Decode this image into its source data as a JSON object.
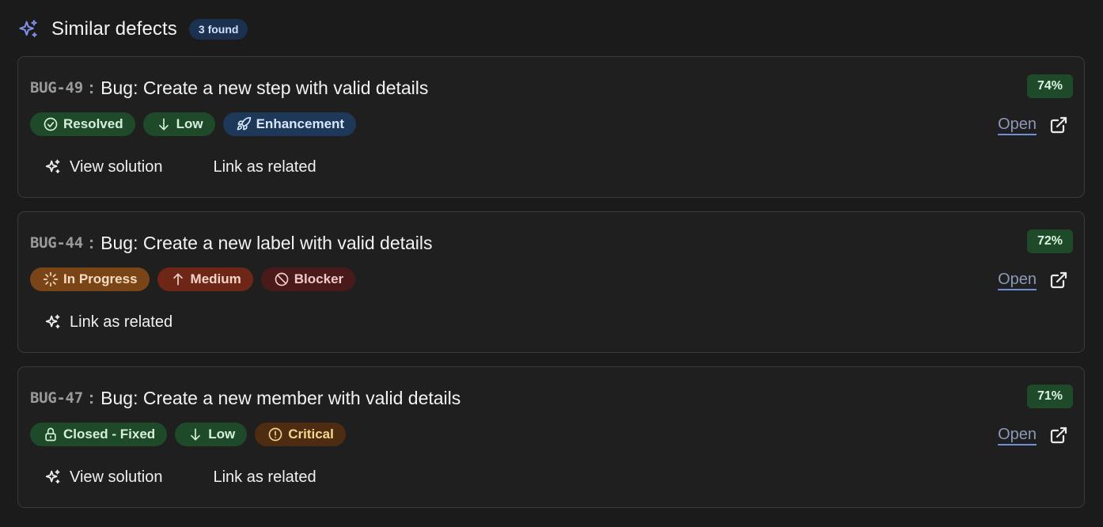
{
  "header": {
    "title": "Similar defects",
    "count": "3 found"
  },
  "defects": [
    {
      "key": "BUG-49",
      "title": "Bug: Create a new step with valid details",
      "score": "74%",
      "tags": [
        {
          "label": "Resolved",
          "icon": "check-circle-icon",
          "color": "#1f4a2a"
        },
        {
          "label": "Low",
          "icon": "arrow-down-icon",
          "color": "#1f4a2a"
        },
        {
          "label": "Enhancement",
          "icon": "rocket-icon",
          "color": "#1d3859"
        }
      ],
      "open_label": "Open",
      "actions": [
        "View solution",
        "Link as related"
      ]
    },
    {
      "key": "BUG-44",
      "title": "Bug: Create a new label with valid details",
      "score": "72%",
      "tags": [
        {
          "label": "In Progress",
          "icon": "loader-icon",
          "color": "#7a4516"
        },
        {
          "label": "Medium",
          "icon": "arrow-up-icon",
          "color": "#6e2616"
        },
        {
          "label": "Blocker",
          "icon": "ban-icon",
          "color": "#4a1a1a"
        }
      ],
      "open_label": "Open",
      "actions": [
        "Link as related"
      ]
    },
    {
      "key": "BUG-47",
      "title": "Bug: Create a new member with valid details",
      "score": "71%",
      "tags": [
        {
          "label": "Closed - Fixed",
          "icon": "lock-icon",
          "color": "#1f4a2a"
        },
        {
          "label": "Low",
          "icon": "arrow-down-icon",
          "color": "#1f4a2a"
        },
        {
          "label": "Critical",
          "icon": "alert-circle-icon",
          "color": "#4d2c12"
        }
      ],
      "open_label": "Open",
      "actions": [
        "View solution",
        "Link as related"
      ]
    }
  ]
}
